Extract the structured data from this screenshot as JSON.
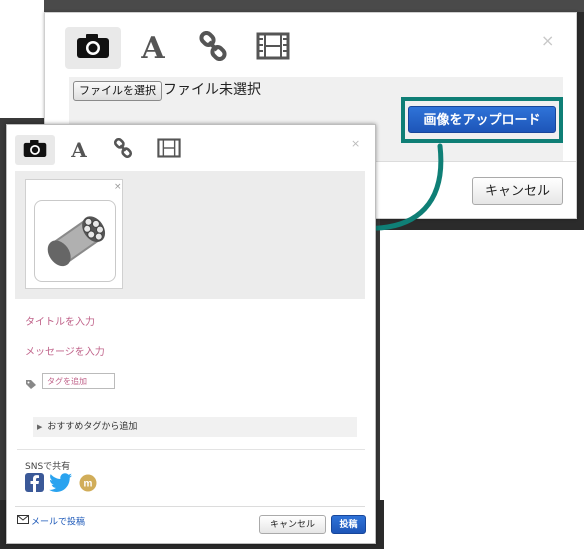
{
  "upload_dialog": {
    "tabs": [
      {
        "icon": "camera-icon",
        "active": true
      },
      {
        "icon": "text-icon",
        "label": "A"
      },
      {
        "icon": "link-icon"
      },
      {
        "icon": "film-icon"
      }
    ],
    "close": "×",
    "file_button": "ファイルを選択",
    "file_status": "ファイル未選択",
    "upload_button": "画像をアップロード",
    "cancel_button": "キャンセル",
    "highlight_color": "#0f7f76",
    "button_color": "#1d55b8"
  },
  "post_dialog": {
    "tabs": [
      {
        "icon": "camera-icon",
        "active": true
      },
      {
        "icon": "text-icon",
        "label": "A"
      },
      {
        "icon": "link-icon"
      },
      {
        "icon": "film-icon"
      }
    ],
    "close": "×",
    "thumbnail_close": "×",
    "thumbnail_icon": "revolver-cylinder-icon",
    "title_placeholder": "タイトルを入力",
    "message_placeholder": "メッセージを入力",
    "tag_placeholder": "タグを追加",
    "recommended_tags": "おすすめタグから追加",
    "sns_label": "SNSで共有",
    "sns_icons": [
      "facebook-icon",
      "twitter-icon",
      "mixi-icon"
    ],
    "mail_link": "メールで投稿",
    "cancel_button": "キャンセル",
    "post_button": "投稿",
    "placeholder_color": "#c0638a"
  }
}
